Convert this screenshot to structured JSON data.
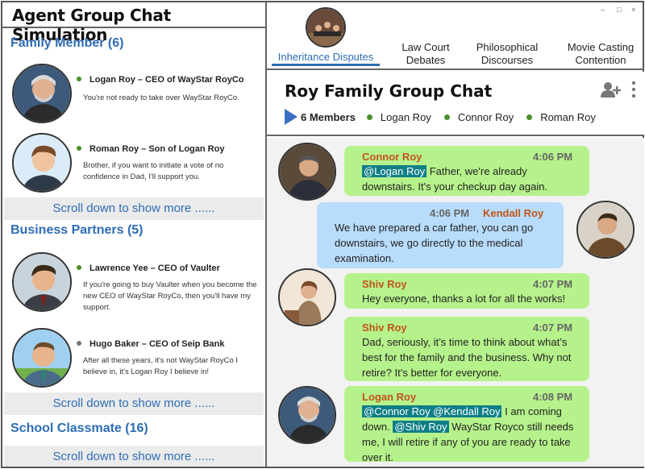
{
  "app_title": "Agent Group Chat Simulation",
  "sections": [
    {
      "title": "Family Member (6)",
      "contacts": [
        {
          "name": "Logan Roy – CEO of WayStar RoyCo",
          "status": "online",
          "message": "You're not ready to take over WayStar RoyCo."
        },
        {
          "name": "Roman Roy – Son of Logan Roy",
          "status": "online",
          "message": "Brother, if you want to initiate a vote of no confidence in Dad, I'll support you."
        }
      ],
      "scroll_hint": "Scroll down to show more ......"
    },
    {
      "title": "Business Partners (5)",
      "contacts": [
        {
          "name": "Lawrence Yee – CEO of Vaulter",
          "status": "online",
          "message": "If you're going to buy Vaulter when you become the new CEO of WayStar RoyCo, then you'll have my support."
        },
        {
          "name": "Hugo Baker – CEO of Seip Bank",
          "status": "offline",
          "message": "After all these years, it's not WayStar RoyCo I believe in, it's Logan Roy I believe in!"
        }
      ],
      "scroll_hint": "Scroll down to show more ......"
    },
    {
      "title": "School Classmate (16)",
      "contacts": [],
      "scroll_hint": "Scroll down to show more ......"
    }
  ],
  "tabs": [
    {
      "line1": "Inheritance Disputes",
      "line2": "",
      "active": true
    },
    {
      "line1": "Law Court",
      "line2": "Debates",
      "active": false
    },
    {
      "line1": "Philosophical",
      "line2": "Discourses",
      "active": false
    },
    {
      "line1": "Movie Casting",
      "line2": "Contention",
      "active": false
    }
  ],
  "window_controls": {
    "minimize": "–",
    "maximize": "□",
    "close": "×"
  },
  "chat": {
    "title": "Roy Family Group Chat",
    "member_count": "6 Members",
    "members": [
      "Logan Roy",
      "Connor Roy",
      "Roman Roy"
    ],
    "messages": [
      {
        "sender": "Connor Roy",
        "time": "4:06 PM",
        "mentions": [
          "@Logan Roy"
        ],
        "text": "Father, we're already downstairs. It's your checkup day again.",
        "side": "left"
      },
      {
        "sender": "Kendall Roy",
        "time": "4:06 PM",
        "mentions": [],
        "text": "We have prepared a car father, you can go downstairs, we go directly to the medical examination.",
        "side": "right"
      },
      {
        "sender": "Shiv Roy",
        "time": "4:07 PM",
        "mentions": [],
        "text": "Hey everyone, thanks a lot for all the works!",
        "side": "left"
      },
      {
        "sender": "Shiv Roy",
        "time": "4:07 PM",
        "mentions": [],
        "text": "Dad, seriously, it’s time to think about what’s best for the family and the business. Why not retire? It’s better for everyone.",
        "side": "left"
      },
      {
        "sender": "Logan Roy",
        "time": "4:08 PM",
        "mentions": [
          "@Connor Roy @Kendall Roy",
          "@Shiv Roy"
        ],
        "text_part1": "I am coming down.",
        "text_part2": "WayStar Royco still needs me, I will retire if any of you are ready to take over it.",
        "side": "left"
      }
    ]
  },
  "colors": {
    "accent": "#2e6db4",
    "online": "#4a8f2a",
    "offline": "#777777",
    "bubble_green": "#b6f28b",
    "bubble_blue": "#b8dcfb",
    "mention_bg": "#0f7f86",
    "sender_name": "#c0541a"
  },
  "icons": {
    "add_user": "add-user-icon",
    "more": "more-vertical-icon",
    "members_arrow": "triangle-right-icon"
  }
}
